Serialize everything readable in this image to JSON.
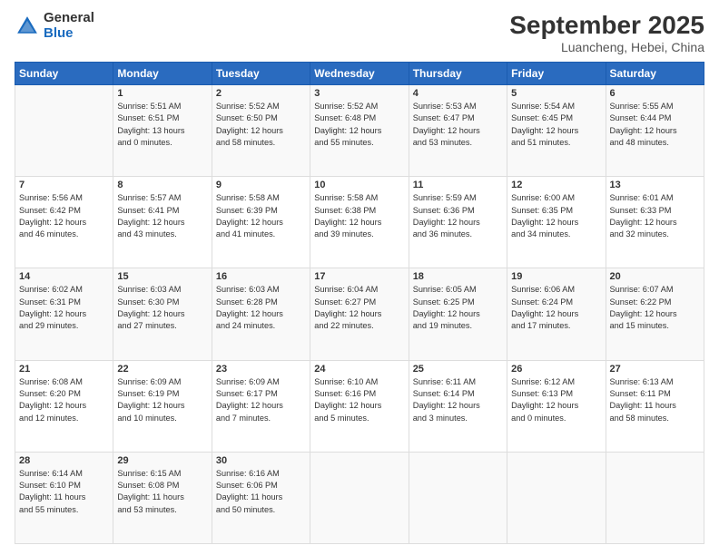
{
  "logo": {
    "general": "General",
    "blue": "Blue"
  },
  "header": {
    "month": "September 2025",
    "location": "Luancheng, Hebei, China"
  },
  "days": [
    "Sunday",
    "Monday",
    "Tuesday",
    "Wednesday",
    "Thursday",
    "Friday",
    "Saturday"
  ],
  "weeks": [
    [
      {
        "num": "",
        "info": ""
      },
      {
        "num": "1",
        "info": "Sunrise: 5:51 AM\nSunset: 6:51 PM\nDaylight: 13 hours\nand 0 minutes."
      },
      {
        "num": "2",
        "info": "Sunrise: 5:52 AM\nSunset: 6:50 PM\nDaylight: 12 hours\nand 58 minutes."
      },
      {
        "num": "3",
        "info": "Sunrise: 5:52 AM\nSunset: 6:48 PM\nDaylight: 12 hours\nand 55 minutes."
      },
      {
        "num": "4",
        "info": "Sunrise: 5:53 AM\nSunset: 6:47 PM\nDaylight: 12 hours\nand 53 minutes."
      },
      {
        "num": "5",
        "info": "Sunrise: 5:54 AM\nSunset: 6:45 PM\nDaylight: 12 hours\nand 51 minutes."
      },
      {
        "num": "6",
        "info": "Sunrise: 5:55 AM\nSunset: 6:44 PM\nDaylight: 12 hours\nand 48 minutes."
      }
    ],
    [
      {
        "num": "7",
        "info": "Sunrise: 5:56 AM\nSunset: 6:42 PM\nDaylight: 12 hours\nand 46 minutes."
      },
      {
        "num": "8",
        "info": "Sunrise: 5:57 AM\nSunset: 6:41 PM\nDaylight: 12 hours\nand 43 minutes."
      },
      {
        "num": "9",
        "info": "Sunrise: 5:58 AM\nSunset: 6:39 PM\nDaylight: 12 hours\nand 41 minutes."
      },
      {
        "num": "10",
        "info": "Sunrise: 5:58 AM\nSunset: 6:38 PM\nDaylight: 12 hours\nand 39 minutes."
      },
      {
        "num": "11",
        "info": "Sunrise: 5:59 AM\nSunset: 6:36 PM\nDaylight: 12 hours\nand 36 minutes."
      },
      {
        "num": "12",
        "info": "Sunrise: 6:00 AM\nSunset: 6:35 PM\nDaylight: 12 hours\nand 34 minutes."
      },
      {
        "num": "13",
        "info": "Sunrise: 6:01 AM\nSunset: 6:33 PM\nDaylight: 12 hours\nand 32 minutes."
      }
    ],
    [
      {
        "num": "14",
        "info": "Sunrise: 6:02 AM\nSunset: 6:31 PM\nDaylight: 12 hours\nand 29 minutes."
      },
      {
        "num": "15",
        "info": "Sunrise: 6:03 AM\nSunset: 6:30 PM\nDaylight: 12 hours\nand 27 minutes."
      },
      {
        "num": "16",
        "info": "Sunrise: 6:03 AM\nSunset: 6:28 PM\nDaylight: 12 hours\nand 24 minutes."
      },
      {
        "num": "17",
        "info": "Sunrise: 6:04 AM\nSunset: 6:27 PM\nDaylight: 12 hours\nand 22 minutes."
      },
      {
        "num": "18",
        "info": "Sunrise: 6:05 AM\nSunset: 6:25 PM\nDaylight: 12 hours\nand 19 minutes."
      },
      {
        "num": "19",
        "info": "Sunrise: 6:06 AM\nSunset: 6:24 PM\nDaylight: 12 hours\nand 17 minutes."
      },
      {
        "num": "20",
        "info": "Sunrise: 6:07 AM\nSunset: 6:22 PM\nDaylight: 12 hours\nand 15 minutes."
      }
    ],
    [
      {
        "num": "21",
        "info": "Sunrise: 6:08 AM\nSunset: 6:20 PM\nDaylight: 12 hours\nand 12 minutes."
      },
      {
        "num": "22",
        "info": "Sunrise: 6:09 AM\nSunset: 6:19 PM\nDaylight: 12 hours\nand 10 minutes."
      },
      {
        "num": "23",
        "info": "Sunrise: 6:09 AM\nSunset: 6:17 PM\nDaylight: 12 hours\nand 7 minutes."
      },
      {
        "num": "24",
        "info": "Sunrise: 6:10 AM\nSunset: 6:16 PM\nDaylight: 12 hours\nand 5 minutes."
      },
      {
        "num": "25",
        "info": "Sunrise: 6:11 AM\nSunset: 6:14 PM\nDaylight: 12 hours\nand 3 minutes."
      },
      {
        "num": "26",
        "info": "Sunrise: 6:12 AM\nSunset: 6:13 PM\nDaylight: 12 hours\nand 0 minutes."
      },
      {
        "num": "27",
        "info": "Sunrise: 6:13 AM\nSunset: 6:11 PM\nDaylight: 11 hours\nand 58 minutes."
      }
    ],
    [
      {
        "num": "28",
        "info": "Sunrise: 6:14 AM\nSunset: 6:10 PM\nDaylight: 11 hours\nand 55 minutes."
      },
      {
        "num": "29",
        "info": "Sunrise: 6:15 AM\nSunset: 6:08 PM\nDaylight: 11 hours\nand 53 minutes."
      },
      {
        "num": "30",
        "info": "Sunrise: 6:16 AM\nSunset: 6:06 PM\nDaylight: 11 hours\nand 50 minutes."
      },
      {
        "num": "",
        "info": ""
      },
      {
        "num": "",
        "info": ""
      },
      {
        "num": "",
        "info": ""
      },
      {
        "num": "",
        "info": ""
      }
    ]
  ]
}
